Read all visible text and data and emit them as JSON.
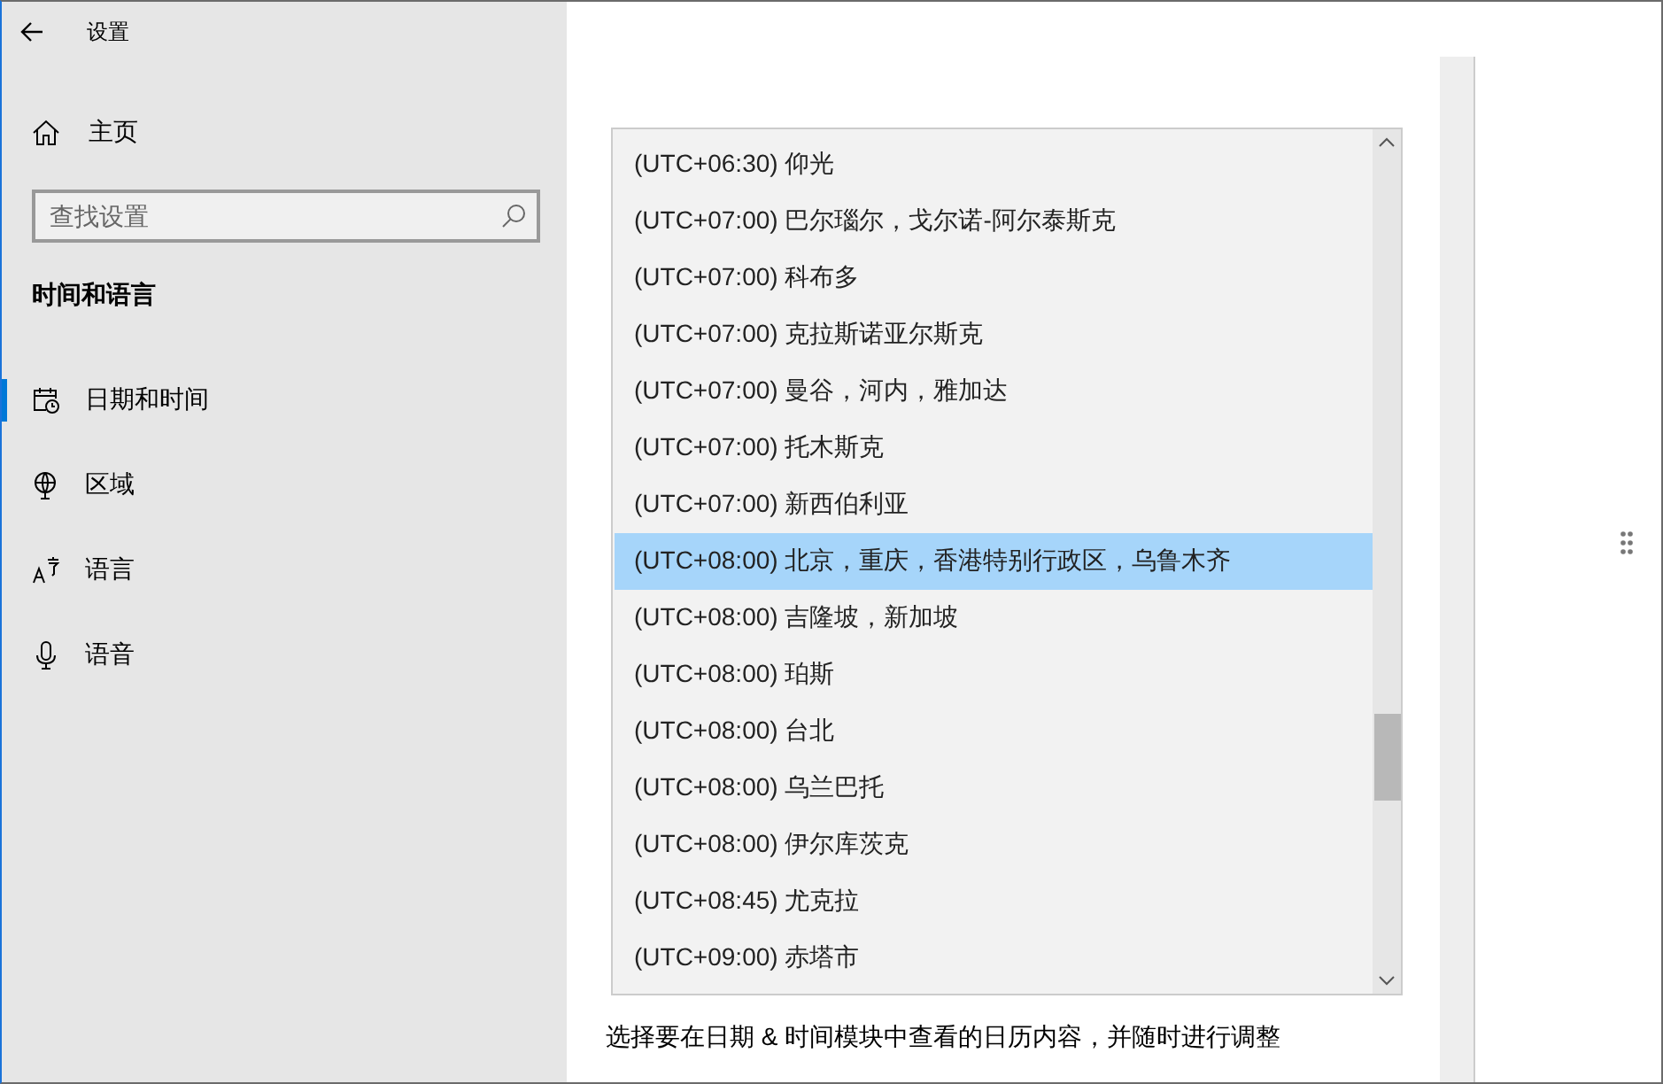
{
  "window": {
    "title": "设置"
  },
  "sidebar": {
    "home": "主页",
    "search": {
      "placeholder": "查找设置"
    },
    "section": "时间和语言",
    "items": [
      {
        "label": "日期和时间",
        "selected": true
      },
      {
        "label": "区域",
        "selected": false
      },
      {
        "label": "语言",
        "selected": false
      },
      {
        "label": "语音",
        "selected": false
      }
    ]
  },
  "page": {
    "description": "选择要在日期 & 时间模块中查看的日历内容，并随时进行调整"
  },
  "timezone_dropdown": {
    "options": [
      {
        "label": "(UTC+06:30) 仰光",
        "selected": false
      },
      {
        "label": "(UTC+07:00) 巴尔瑙尔，戈尔诺-阿尔泰斯克",
        "selected": false
      },
      {
        "label": "(UTC+07:00) 科布多",
        "selected": false
      },
      {
        "label": "(UTC+07:00) 克拉斯诺亚尔斯克",
        "selected": false
      },
      {
        "label": "(UTC+07:00) 曼谷，河内，雅加达",
        "selected": false
      },
      {
        "label": "(UTC+07:00) 托木斯克",
        "selected": false
      },
      {
        "label": "(UTC+07:00) 新西伯利亚",
        "selected": false
      },
      {
        "label": "(UTC+08:00) 北京，重庆，香港特别行政区，乌鲁木齐",
        "selected": true
      },
      {
        "label": "(UTC+08:00) 吉隆坡，新加坡",
        "selected": false
      },
      {
        "label": "(UTC+08:00) 珀斯",
        "selected": false
      },
      {
        "label": "(UTC+08:00) 台北",
        "selected": false
      },
      {
        "label": "(UTC+08:00) 乌兰巴托",
        "selected": false
      },
      {
        "label": "(UTC+08:00) 伊尔库茨克",
        "selected": false
      },
      {
        "label": "(UTC+08:45) 尤克拉",
        "selected": false
      },
      {
        "label": "(UTC+09:00) 赤塔市",
        "selected": false
      }
    ]
  }
}
